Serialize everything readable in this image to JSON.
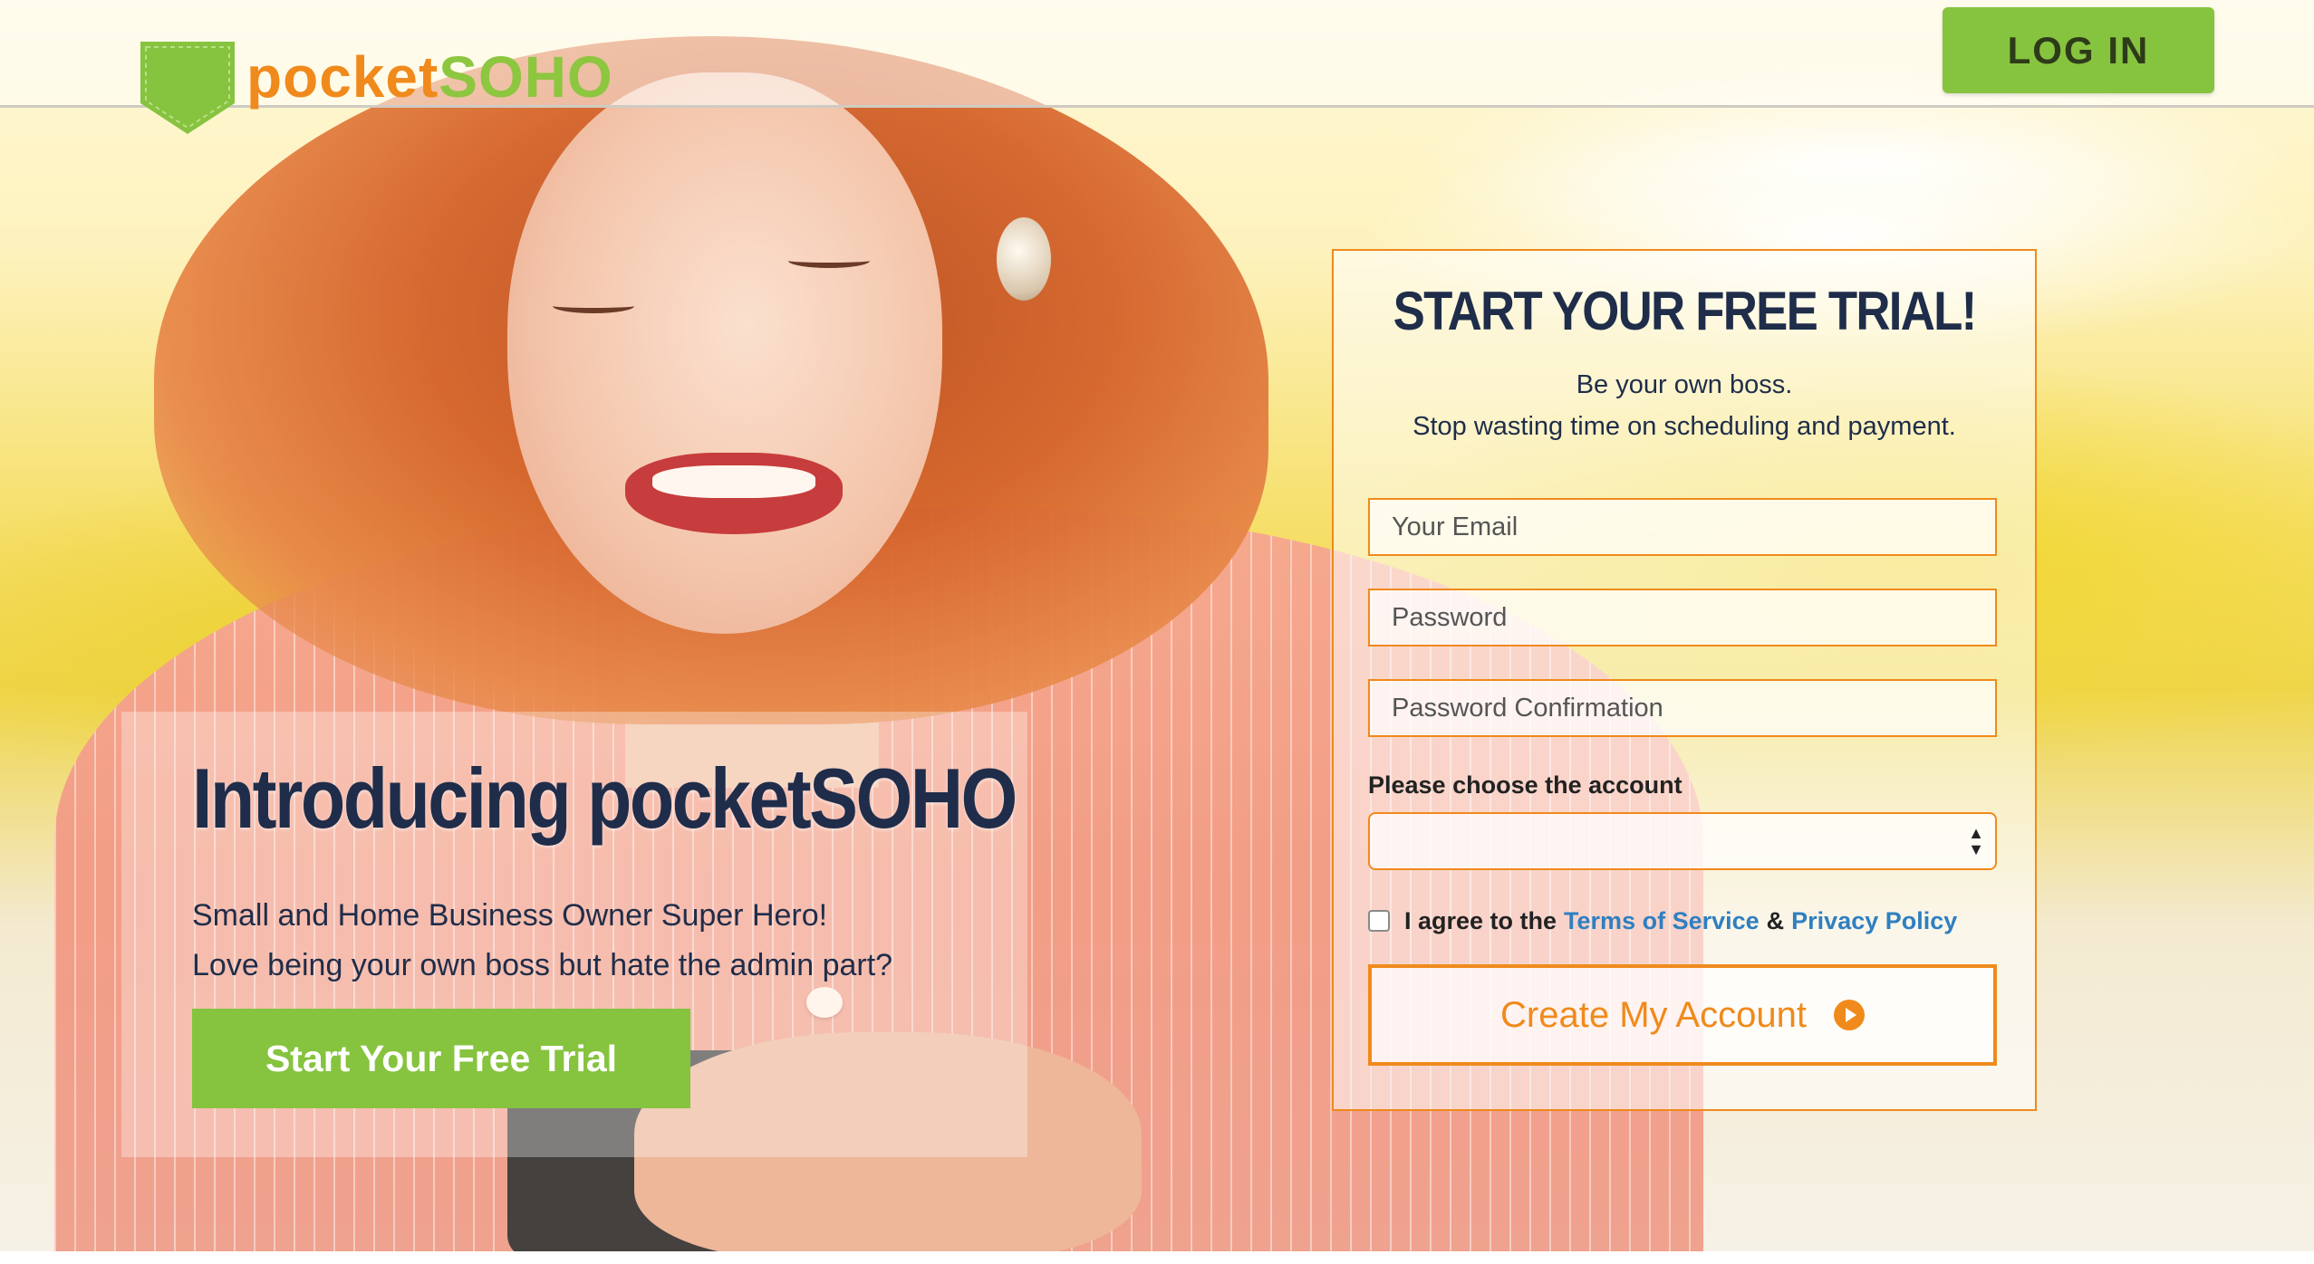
{
  "header": {
    "logo_part1": "pocket",
    "logo_part2": "SOHO",
    "login_label": "LOG IN"
  },
  "intro": {
    "title": "Introducing pocketSOHO",
    "line1": "Small and Home Business Owner Super Hero!",
    "line2": "Love being your own boss but hate the admin part?",
    "cta_label": "Start Your Free Trial"
  },
  "signup": {
    "title": "START YOUR FREE TRIAL!",
    "subtitle1": "Be your own boss.",
    "subtitle2": "Stop wasting time on scheduling and payment.",
    "email_placeholder": "Your Email",
    "password_placeholder": "Password",
    "password_confirm_placeholder": "Password Confirmation",
    "account_label": "Please choose the account",
    "account_selected": "",
    "agree_prefix": "I agree to the",
    "terms_label": "Terms of Service",
    "agree_joiner": "&",
    "privacy_label": "Privacy Policy",
    "agree_checked": false,
    "create_label": "Create My Account"
  },
  "colors": {
    "brand_orange": "#f08a1c",
    "brand_green": "#86c33f",
    "navy_text": "#1f2d4a",
    "link_blue": "#2f7fc1"
  },
  "icons": {
    "logo": "pocket-shield-icon",
    "create": "play-circle-icon",
    "select": "updown-arrows-icon"
  }
}
